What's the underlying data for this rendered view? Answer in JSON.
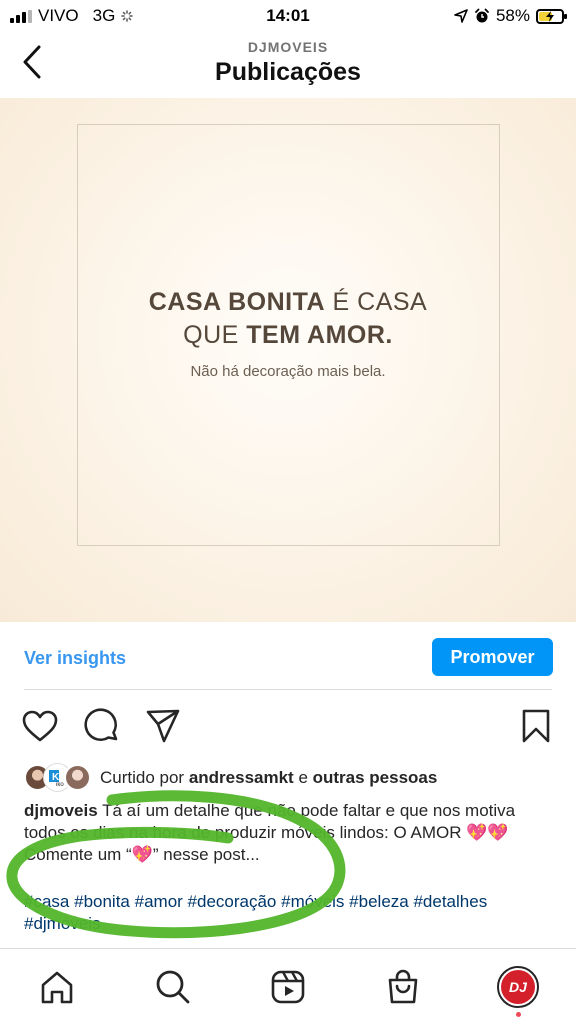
{
  "status_bar": {
    "carrier": "VIVO",
    "network": "3G",
    "time": "14:01",
    "battery": "58%"
  },
  "header": {
    "account": "DJMOVEIS",
    "title": "Publicações"
  },
  "post": {
    "line1_bold": "CASA BONITA",
    "line1_rest": " É CASA",
    "line2_start": "QUE ",
    "line2_bold": "TEM AMOR.",
    "subtitle": "Não há decoração mais bela."
  },
  "insights": {
    "link_label": "Ver insights",
    "promote_label": "Promover"
  },
  "likes": {
    "prefix": "Curtido por ",
    "user": "andressamkt",
    "connector": " e ",
    "others": "outras pessoas"
  },
  "caption": {
    "username": "djmoveis",
    "text": " Tá aí um detalhe que não pode faltar e que nos motiva todos os dias na hora de produzir móveis lindos: O AMOR 💖💖",
    "cta": "Comente um “💖” nesse post..."
  },
  "hashtags": [
    "#casa",
    "#bonita",
    "#amor",
    "#decoração",
    "#móveis",
    "#beleza",
    "#detalhes",
    "#djmóveis"
  ],
  "profile": {
    "initials": "DJ"
  },
  "colors": {
    "link_blue": "#3897f0",
    "button_blue": "#0095f6",
    "hashtag_blue": "#00376b",
    "annotation_green": "#52b52a",
    "brand_red": "#d3202a"
  },
  "icons": [
    "back-chevron-icon",
    "heart-icon",
    "comment-icon",
    "share-icon",
    "bookmark-icon",
    "home-icon",
    "search-icon",
    "reels-icon",
    "shop-icon",
    "location-arrow-icon",
    "alarm-icon",
    "battery-icon"
  ]
}
